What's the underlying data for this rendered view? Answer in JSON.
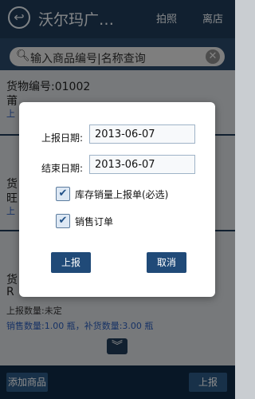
{
  "header": {
    "back_glyph": "↩",
    "title": "沃尔玛广…",
    "photo_label": "拍照",
    "leave_store_label": "离店"
  },
  "search": {
    "placeholder": "输入商品编号|名称查询",
    "icon": "search-icon",
    "clear_icon": "clear-icon"
  },
  "list": {
    "items": [
      {
        "code_text": "货物编号:01002",
        "name_partial": "莆",
        "sub": "上"
      },
      {
        "code_text": "货",
        "name_partial": "旺",
        "sub": "上"
      },
      {
        "code_text": "货",
        "name_partial": "R",
        "sub": "上"
      }
    ],
    "report_quantity_line": "上报数量:未定",
    "stock_line": "销售数量:1.00 瓶，补货数量:3.00 瓶"
  },
  "bottom": {
    "add_goods_label": "添加商品",
    "report_label": "上报"
  },
  "dialog": {
    "report_date_label": "上报日期:",
    "report_date_value": "2013-06-07",
    "end_date_label": "结束日期:",
    "end_date_value": "2013-06-07",
    "checkbox_inventory_label": "库存销量上报单(必选)",
    "checkbox_inventory_checked": true,
    "checkbox_sales_label": "销售订单",
    "checkbox_sales_checked": true,
    "submit_label": "上报",
    "cancel_label": "取消"
  },
  "colors": {
    "header": "#1f3b58",
    "search_bar": "#2b4a6a",
    "bottom_bar": "#102a45",
    "button": "#204a78",
    "accent_link": "#2a5bb8"
  }
}
